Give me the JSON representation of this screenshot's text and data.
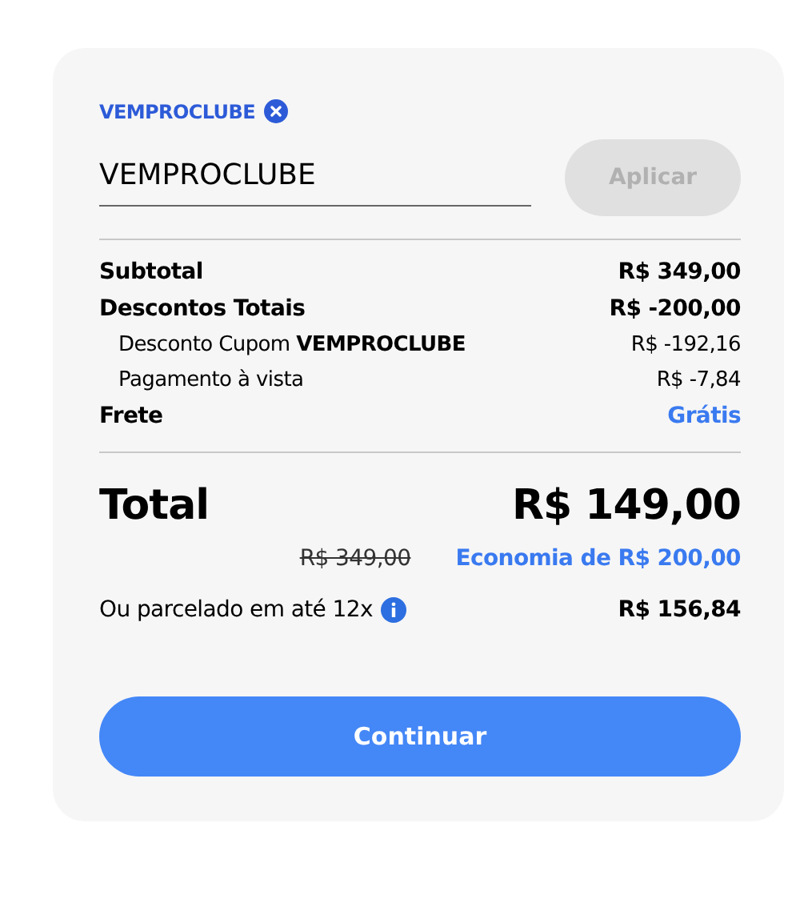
{
  "coupon": {
    "applied_code": "VEMPROCLUBE",
    "input_value": "VEMPROCLUBE",
    "apply_button": {
      "label": "Aplicar",
      "disabled": true
    }
  },
  "summary_rows": [
    {
      "kind": "main",
      "label": "Subtotal",
      "value": "R$ 349,00",
      "accent": false
    },
    {
      "kind": "main",
      "label": "Descontos Totais",
      "value": "R$ -200,00",
      "accent": false
    },
    {
      "kind": "sub",
      "label": "Desconto Cupom **VEMPROCLUBE**",
      "value": "R$ -192,16",
      "accent": false
    },
    {
      "kind": "sub",
      "label": "Pagamento à vista",
      "value": "R$ -7,84",
      "accent": false
    },
    {
      "kind": "main",
      "label": "Frete",
      "value": "Grátis",
      "accent": true
    }
  ],
  "total": {
    "label": "Total",
    "value": "R$ 149,00",
    "original_price": "R$ 349,00",
    "savings": "Economia de R$ 200,00"
  },
  "installments": {
    "label": "Ou parcelado em até 12x",
    "value": "R$ 156,84"
  },
  "continue_button": {
    "label": "Continuar"
  }
}
